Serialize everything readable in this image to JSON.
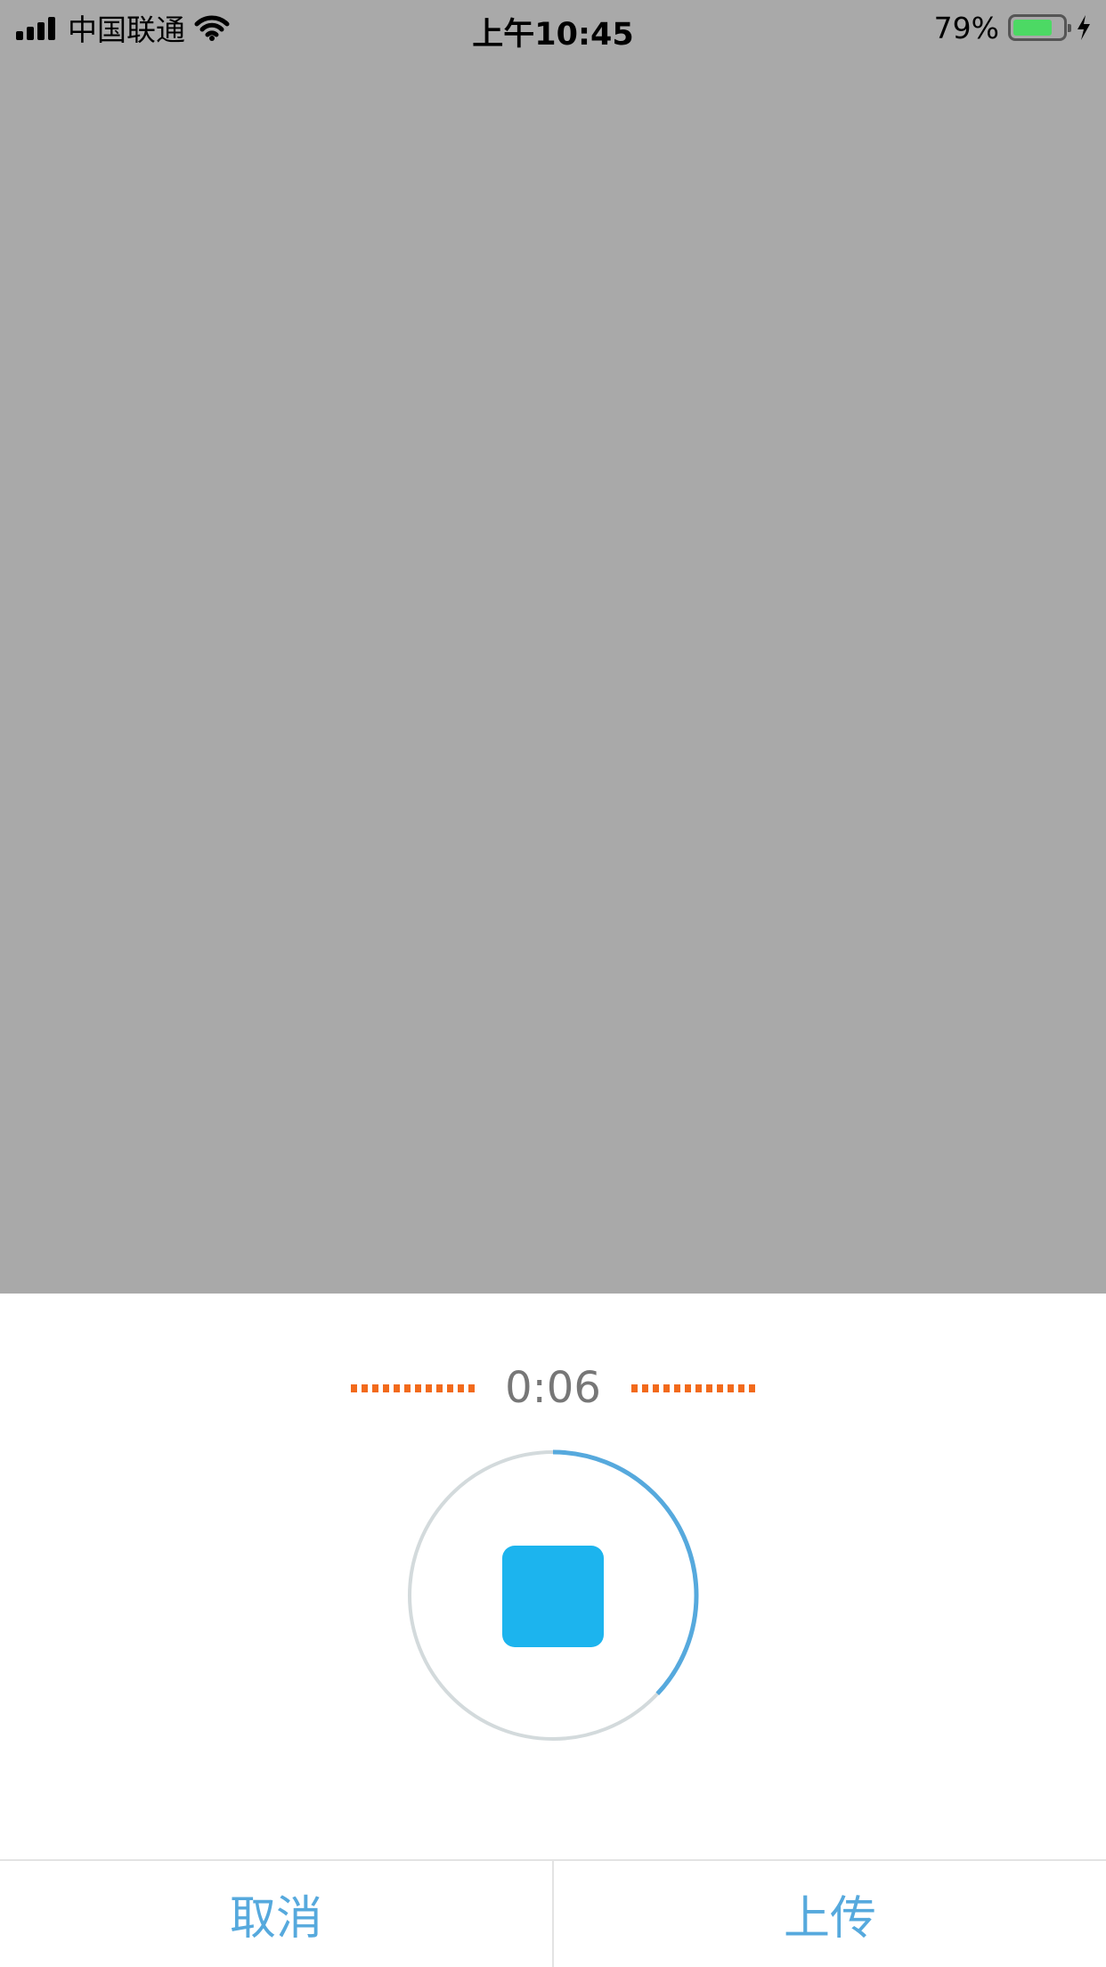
{
  "status_bar": {
    "carrier": "中国联通",
    "time": "上午10:45",
    "battery_percent": "79%",
    "battery_level": 0.79,
    "icons": [
      "signal-icon",
      "wifi-icon",
      "battery-icon",
      "charging-icon"
    ]
  },
  "recorder": {
    "elapsed": "0:06",
    "progress": 0.37,
    "colors": {
      "accent": "#56a9dd",
      "stop": "#1cb4ee",
      "level": "#f26a1b",
      "track": "#d3dadc"
    }
  },
  "actions": {
    "cancel_label": "取消",
    "upload_label": "上传"
  }
}
